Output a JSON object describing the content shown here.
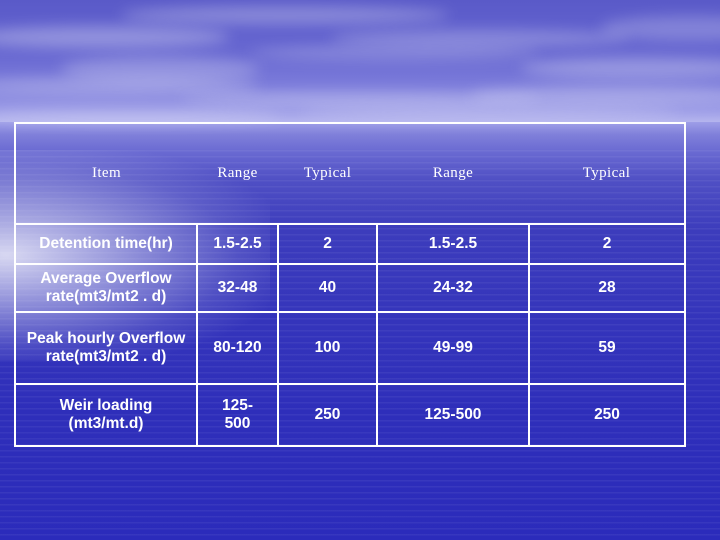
{
  "slide": {
    "background": {
      "scene": "sky-over-ocean",
      "sky_color": "#6a6ad2",
      "ocean_color": "#3434bb",
      "border_color": "#ffffff"
    }
  },
  "table": {
    "headers": [
      "Item",
      "Range",
      "Typical",
      "Range",
      "Typical"
    ],
    "rows": [
      {
        "item": "Detention time(hr)",
        "item_line2": "",
        "range1": "1.5-2.5",
        "typical1": "2",
        "range2": "1.5-2.5",
        "typical2": "2"
      },
      {
        "item": "Average Overflow",
        "item_line2": "rate(mt3/mt2 . d)",
        "range1": "32-48",
        "typical1": "40",
        "range2": "24-32",
        "typical2": "28"
      },
      {
        "item": "Peak hourly Overflow",
        "item_line2": "rate(mt3/mt2 . d)",
        "range1": "80-120",
        "typical1": "100",
        "range2": "49-99",
        "typical2": "59"
      },
      {
        "item": "Weir loading",
        "item_line2": "(mt3/mt.d)",
        "range1_line1": "125-",
        "range1_line2": "500",
        "range1": "125-500",
        "typical1": "250",
        "range2": "125-500",
        "typical2": "250"
      }
    ]
  }
}
